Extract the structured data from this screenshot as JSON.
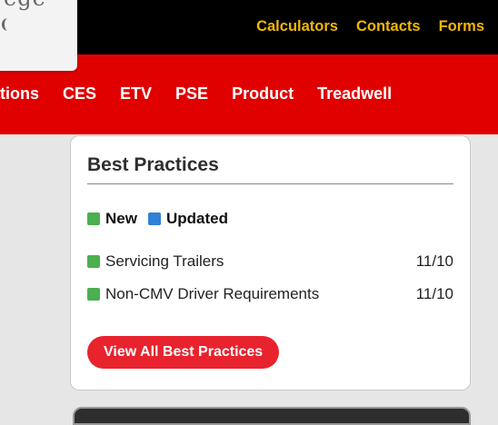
{
  "header": {
    "logo_fragment": "ege",
    "links": [
      "Calculators",
      "Contacts",
      "Forms"
    ],
    "link_color": "#f2b705"
  },
  "nav": {
    "items": [
      "rations",
      "CES",
      "ETV",
      "PSE",
      "Product",
      "Treadwell"
    ],
    "background": "#e00000"
  },
  "best_practices": {
    "title": "Best Practices",
    "legend": [
      {
        "label": "New",
        "color": "#4caf50"
      },
      {
        "label": "Updated",
        "color": "#2f80d6"
      }
    ],
    "items": [
      {
        "title": "Servicing Trailers",
        "date": "11/10",
        "status": "new"
      },
      {
        "title": "Non-CMV Driver Requirements",
        "date": "11/10",
        "status": "new"
      }
    ],
    "view_all_label": "View All Best Practices",
    "button_color": "#e8232e"
  }
}
